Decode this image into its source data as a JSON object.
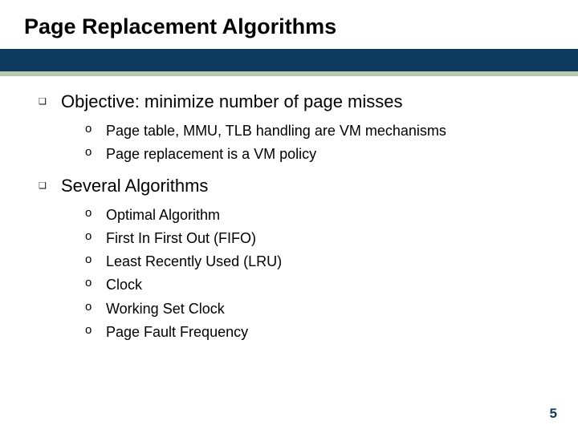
{
  "title": "Page Replacement Algorithms",
  "bullets": [
    {
      "text": "Objective: minimize number of page misses",
      "sub": [
        "Page table, MMU, TLB handling are VM mechanisms",
        "Page replacement is a VM policy"
      ]
    },
    {
      "text": "Several Algorithms",
      "sub": [
        "Optimal Algorithm",
        "First In First Out (FIFO)",
        "Least Recently Used (LRU)",
        "Clock",
        "Working Set Clock",
        "Page Fault Frequency"
      ]
    }
  ],
  "glyphs": {
    "square": "❑",
    "circle": "o"
  },
  "page_number": "5"
}
